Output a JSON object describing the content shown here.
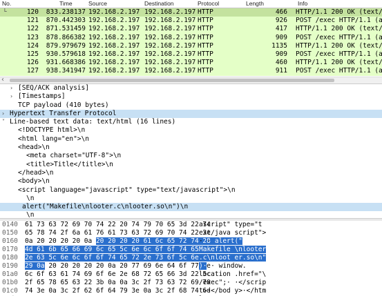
{
  "packet_list": {
    "columns": [
      "No.",
      "Time",
      "Source",
      "Destination",
      "Protocol",
      "Length",
      "Info"
    ],
    "rows": [
      {
        "no": "120",
        "time": "833.238137",
        "src": "192.168.2.197",
        "dst": "192.168.2.197",
        "proto": "HTTP",
        "len": "466",
        "info": "HTTP/1.1 200 OK  (text/html)",
        "selected": true
      },
      {
        "no": "121",
        "time": "870.442303",
        "src": "192.168.2.197",
        "dst": "192.168.2.197",
        "proto": "HTTP",
        "len": "926",
        "info": "POST /exec HTTP/1.1  (application"
      },
      {
        "no": "122",
        "time": "871.531459",
        "src": "192.168.2.197",
        "dst": "192.168.2.197",
        "proto": "HTTP",
        "len": "417",
        "info": "HTTP/1.1 200 OK  (text/html)"
      },
      {
        "no": "123",
        "time": "878.866382",
        "src": "192.168.2.197",
        "dst": "192.168.2.197",
        "proto": "HTTP",
        "len": "909",
        "info": "POST /exec HTTP/1.1  (application"
      },
      {
        "no": "124",
        "time": "879.979679",
        "src": "192.168.2.197",
        "dst": "192.168.2.197",
        "proto": "HTTP",
        "len": "1135",
        "info": "HTTP/1.1 200 OK  (text/html)"
      },
      {
        "no": "125",
        "time": "930.579618",
        "src": "192.168.2.197",
        "dst": "192.168.2.197",
        "proto": "HTTP",
        "len": "909",
        "info": "POST /exec HTTP/1.1  (application"
      },
      {
        "no": "126",
        "time": "931.668386",
        "src": "192.168.2.197",
        "dst": "192.168.2.197",
        "proto": "HTTP",
        "len": "460",
        "info": "HTTP/1.1 200 OK  (text/html)"
      },
      {
        "no": "127",
        "time": "938.341947",
        "src": "192.168.2.197",
        "dst": "192.168.2.197",
        "proto": "HTTP",
        "len": "911",
        "info": "POST /exec HTTP/1.1  (application"
      }
    ]
  },
  "details": [
    {
      "indent": 1,
      "toggle": ">",
      "text": "[SEQ/ACK analysis]"
    },
    {
      "indent": 1,
      "toggle": ">",
      "text": "[Timestamps]"
    },
    {
      "indent": 1,
      "toggle": "",
      "text": "TCP payload (410 bytes)"
    },
    {
      "indent": 0,
      "toggle": ">",
      "text": "Hypertext Transfer Protocol",
      "style": "hl"
    },
    {
      "indent": 0,
      "toggle": "v",
      "text": "Line-based text data: text/html (16 lines)"
    },
    {
      "indent": 1,
      "toggle": "",
      "text": "<!DOCTYPE html>\\n"
    },
    {
      "indent": 1,
      "toggle": "",
      "text": "<html lang=\"en\">\\n"
    },
    {
      "indent": 1,
      "toggle": "",
      "text": "<head>\\n"
    },
    {
      "indent": 2,
      "toggle": "",
      "text": "<meta charset=\"UTF-8\">\\n"
    },
    {
      "indent": 2,
      "toggle": "",
      "text": "<title>Title</title>\\n"
    },
    {
      "indent": 1,
      "toggle": "",
      "text": "</head>\\n"
    },
    {
      "indent": 1,
      "toggle": "",
      "text": "<body>\\n"
    },
    {
      "indent": 1,
      "toggle": "",
      "text": "<script language=\"javascript\" type=\"text/javascript\">\\n"
    },
    {
      "indent": 2,
      "toggle": "",
      "text": "\\n"
    },
    {
      "indent": 1.5,
      "toggle": "",
      "text": "alert(\"Makefile\\nlooter.c\\nlooter.so\\n\")\\n",
      "style": "sel"
    },
    {
      "indent": 2,
      "toggle": "",
      "text": "\\n"
    }
  ],
  "bytes": [
    {
      "off": "0140",
      "hex": [
        {
          "t": "61 73 63 72 69 70 74 22 20 74 79 70 65 3d 22 74"
        }
      ],
      "asc": [
        {
          "t": "ascript\" type=\"t"
        }
      ]
    },
    {
      "off": "0150",
      "hex": [
        {
          "t": "65 78 74 2f 6a 61 76 61 73 63 72 69 70 74 22 3e"
        }
      ],
      "asc": [
        {
          "t": "ext/java script\">"
        }
      ]
    },
    {
      "off": "0160",
      "hex": [
        {
          "t": "0a 20 20 20 20 0a "
        },
        {
          "t": "20 20 20 20 61 6c 65 72 74 28 22",
          "s": 1
        }
      ],
      "asc": [
        {
          "t": "·    · "
        },
        {
          "t": "    alert(\"",
          "s": 1
        }
      ]
    },
    {
      "off": "0170",
      "hex": [
        {
          "t": "4d 61 6b 65 66 69 6c 65 5c 6e 6c 6f 6f 74 65 72",
          "s": 1
        }
      ],
      "asc": [
        {
          "t": "Makefile \\nlooter",
          "s": 1
        }
      ]
    },
    {
      "off": "0180",
      "hex": [
        {
          "t": "2e 63 5c 6e 6c 6f 6f 74 65 72 2e 73 6f 5c 6e 22",
          "s": 1
        }
      ],
      "asc": [
        {
          "t": ".c\\nloot er.so\\n\"",
          "s": 1
        }
      ]
    },
    {
      "off": "0190",
      "hex": [
        {
          "t": "29 0a",
          "s": 1
        },
        {
          "t": " 20 20 20 20 20 0a 20 77 69 6e 64 6f 77 2e"
        }
      ],
      "asc": [
        {
          "t": ")·",
          "s": 1
        },
        {
          "t": "    ·  window."
        }
      ]
    },
    {
      "off": "01a0",
      "hex": [
        {
          "t": "6c 6f 63 61 74 69 6f 6e 2e 68 72 65 66 3d 22 5c"
        }
      ],
      "asc": [
        {
          "t": "location .href=\"\\"
        }
      ]
    },
    {
      "off": "01b0",
      "hex": [
        {
          "t": "2f 65 78 65 63 22 3b 0a 0a 3c 2f 73 63 72 69 70"
        }
      ],
      "asc": [
        {
          "t": "/exec\";· ·</scrip"
        }
      ]
    },
    {
      "off": "01c0",
      "hex": [
        {
          "t": "74 3e 0a 3c 2f 62 6f 64 79 3e 0a 3c 2f 68 74 6d"
        }
      ],
      "asc": [
        {
          "t": "t>·</bod y>·</htm"
        }
      ]
    },
    {
      "off": "01d0",
      "hex": [
        {
          "t": "6c 3e"
        }
      ],
      "asc": [
        {
          "t": "l>"
        }
      ]
    }
  ]
}
